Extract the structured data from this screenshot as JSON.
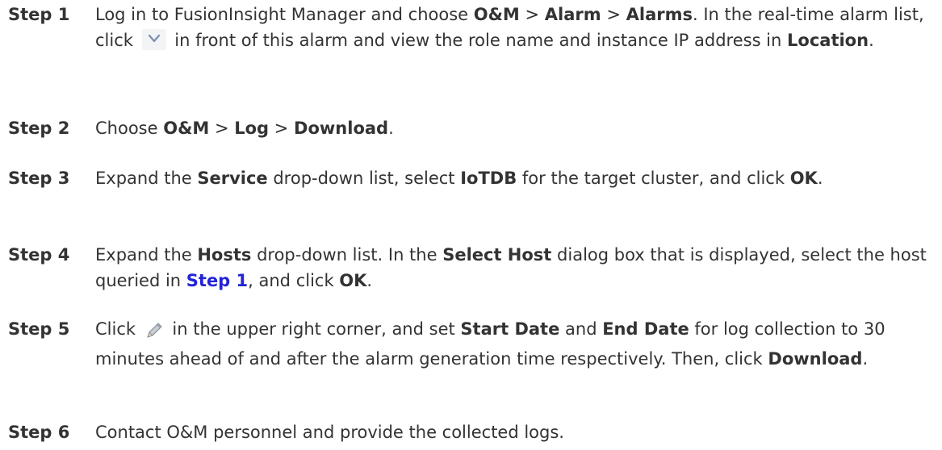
{
  "steps": [
    {
      "label": "Step 1",
      "segments": [
        {
          "t": "text",
          "v": "Log in to FusionInsight Manager and choose "
        },
        {
          "t": "bold",
          "v": "O&M"
        },
        {
          "t": "text",
          "v": " > "
        },
        {
          "t": "bold",
          "v": "Alarm"
        },
        {
          "t": "text",
          "v": " > "
        },
        {
          "t": "bold",
          "v": "Alarms"
        },
        {
          "t": "text",
          "v": ". In the real-time alarm list, click "
        },
        {
          "t": "icon",
          "v": "chevron-down-icon"
        },
        {
          "t": "text",
          "v": " in front of this alarm and view the role name and instance IP address in "
        },
        {
          "t": "bold",
          "v": "Location"
        },
        {
          "t": "text",
          "v": "."
        }
      ]
    },
    {
      "label": "Step 2",
      "segments": [
        {
          "t": "text",
          "v": "Choose "
        },
        {
          "t": "bold",
          "v": "O&M"
        },
        {
          "t": "text",
          "v": " > "
        },
        {
          "t": "bold",
          "v": "Log"
        },
        {
          "t": "text",
          "v": " > "
        },
        {
          "t": "bold",
          "v": "Download"
        },
        {
          "t": "text",
          "v": "."
        }
      ]
    },
    {
      "label": "Step 3",
      "segments": [
        {
          "t": "text",
          "v": "Expand the "
        },
        {
          "t": "bold",
          "v": "Service"
        },
        {
          "t": "text",
          "v": " drop-down list, select "
        },
        {
          "t": "bold",
          "v": "IoTDB"
        },
        {
          "t": "text",
          "v": " for the target cluster, and click "
        },
        {
          "t": "bold",
          "v": "OK"
        },
        {
          "t": "text",
          "v": "."
        }
      ]
    },
    {
      "label": "Step 4",
      "segments": [
        {
          "t": "text",
          "v": "Expand the "
        },
        {
          "t": "bold",
          "v": "Hosts"
        },
        {
          "t": "text",
          "v": " drop-down list. In the "
        },
        {
          "t": "bold",
          "v": "Select Host"
        },
        {
          "t": "text",
          "v": " dialog box that is displayed, select the host queried in "
        },
        {
          "t": "link",
          "v": "Step 1"
        },
        {
          "t": "text",
          "v": ", and click "
        },
        {
          "t": "bold",
          "v": "OK"
        },
        {
          "t": "text",
          "v": "."
        }
      ]
    },
    {
      "label": "Step 5",
      "segments": [
        {
          "t": "text",
          "v": "Click "
        },
        {
          "t": "icon",
          "v": "pencil-icon"
        },
        {
          "t": "text",
          "v": " in the upper right corner, and set "
        },
        {
          "t": "bold",
          "v": "Start Date"
        },
        {
          "t": "text",
          "v": " and "
        },
        {
          "t": "bold",
          "v": "End Date"
        },
        {
          "t": "text",
          "v": " for log collection to 30 minutes ahead of and after the alarm generation time respectively. Then, click "
        },
        {
          "t": "bold",
          "v": "Download"
        },
        {
          "t": "text",
          "v": "."
        }
      ]
    },
    {
      "label": "Step 6",
      "segments": [
        {
          "t": "text",
          "v": "Contact O&M personnel and provide the collected logs."
        }
      ]
    }
  ],
  "colors": {
    "text": "#333333",
    "link": "#2323d8",
    "icon_bg": "#f3f4f6",
    "chevron": "#7a8eb0"
  }
}
